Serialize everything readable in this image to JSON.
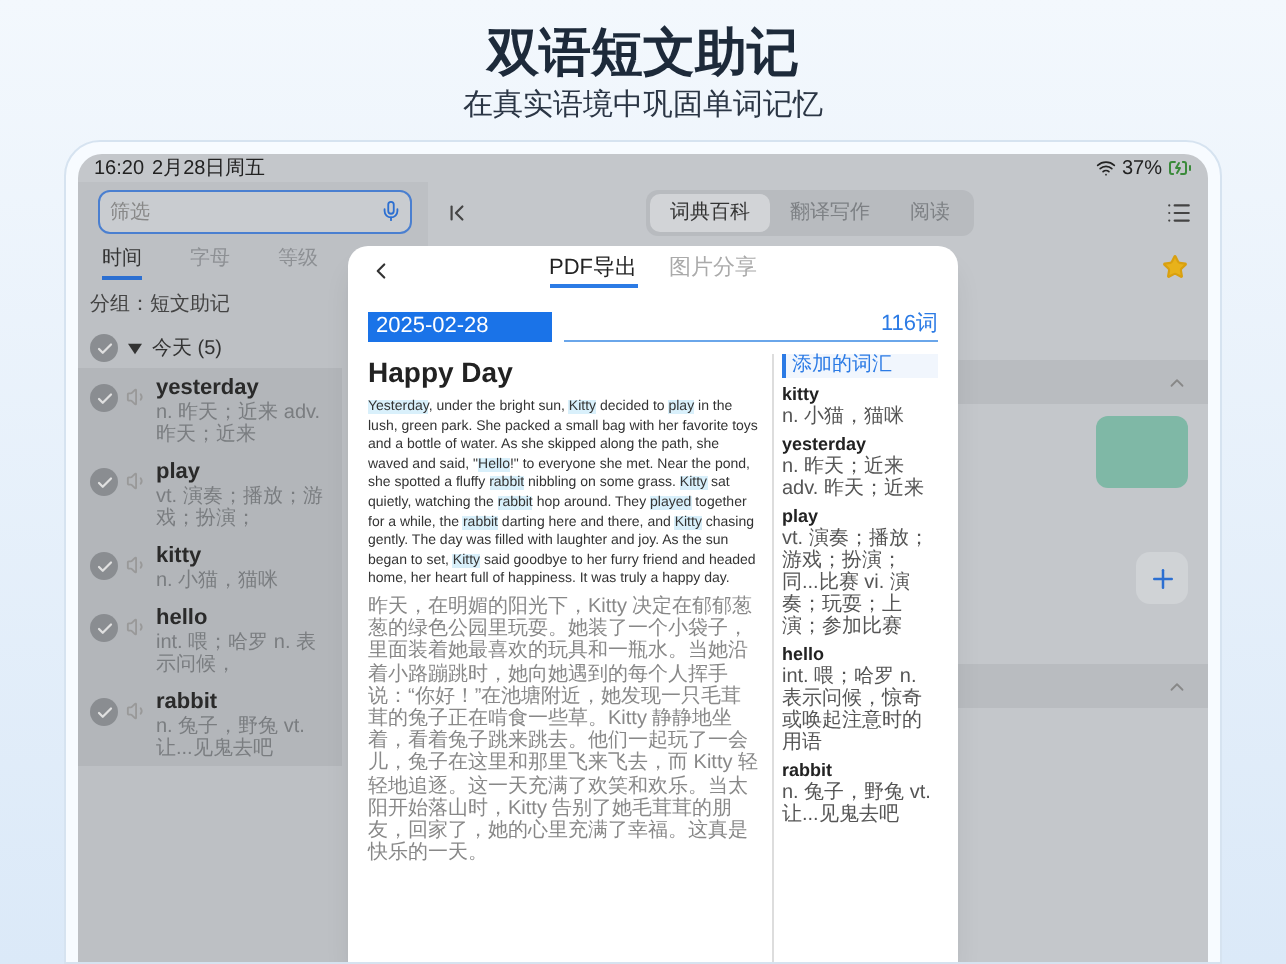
{
  "header": {
    "title": "双语短文助记",
    "subtitle": "在真实语境中巩固单词记忆"
  },
  "status_bar": {
    "time": "16:20",
    "date": "2月28日周五",
    "battery": "37%"
  },
  "sidebar": {
    "search": {
      "placeholder": "筛选"
    },
    "tabs": [
      {
        "label": "时间",
        "selected": true
      },
      {
        "label": "字母",
        "selected": false
      },
      {
        "label": "等级",
        "selected": false
      }
    ],
    "group_label": "分组：短文助记",
    "group": {
      "title": "今天 (5)",
      "checked": true,
      "expanded": true,
      "items": [
        {
          "word": "yesterday",
          "definition": "n. 昨天；近来 adv. 昨天；近来",
          "checked": true
        },
        {
          "word": "play",
          "definition": "vt. 演奏；播放；游戏；扮演；",
          "checked": true
        },
        {
          "word": "kitty",
          "definition": "n. 小猫，猫咪",
          "checked": true
        },
        {
          "word": "hello",
          "definition": "int. 喂；哈罗 n. 表示问候，",
          "checked": true
        },
        {
          "word": "rabbit",
          "definition": "n. 兔子，野兔 vt. 让...见鬼去吧",
          "checked": true
        }
      ]
    }
  },
  "toolbar": {
    "tabs": [
      {
        "label": "词典百科",
        "selected": true
      },
      {
        "label": "翻译写作",
        "selected": false
      },
      {
        "label": "阅读",
        "selected": false
      }
    ]
  },
  "main": {
    "favorite": true
  },
  "export_dialog": {
    "tabs": [
      {
        "label": "PDF导出",
        "selected": true
      },
      {
        "label": "图片分享",
        "selected": false
      }
    ],
    "date": "2025-02-28",
    "word_count": "116词",
    "title": "Happy Day",
    "story": [
      {
        "text": "Yesterday",
        "highlighted": true
      },
      {
        "text": ", under the bright sun, ",
        "highlighted": false
      },
      {
        "text": "Kitty",
        "highlighted": true
      },
      {
        "text": " decided to ",
        "highlighted": false
      },
      {
        "text": "play",
        "highlighted": true
      },
      {
        "text": " in the lush, green park. She packed a small bag with her favorite toys and a bottle of water. As she skipped along the path, she waved and said, \"",
        "highlighted": false
      },
      {
        "text": "Hello",
        "highlighted": true
      },
      {
        "text": "!\" to everyone she met. Near the pond, she spotted a fluffy ",
        "highlighted": false
      },
      {
        "text": "rabbit",
        "highlighted": true
      },
      {
        "text": " nibbling on some grass. ",
        "highlighted": false
      },
      {
        "text": "Kitty",
        "highlighted": true
      },
      {
        "text": " sat quietly, watching the ",
        "highlighted": false
      },
      {
        "text": "rabbit",
        "highlighted": true
      },
      {
        "text": " hop around. They ",
        "highlighted": false
      },
      {
        "text": "played",
        "highlighted": true
      },
      {
        "text": " together for a while, the ",
        "highlighted": false
      },
      {
        "text": "rabbit",
        "highlighted": true
      },
      {
        "text": " darting here and there, and ",
        "highlighted": false
      },
      {
        "text": "Kitty",
        "highlighted": true
      },
      {
        "text": " chasing gently. The day was filled with laughter and joy. As the sun began to set, ",
        "highlighted": false
      },
      {
        "text": "Kitty",
        "highlighted": true
      },
      {
        "text": " said goodbye to her furry friend and headed home, her heart full of happiness. It was truly a happy day.",
        "highlighted": false
      }
    ],
    "translation": "昨天，在明媚的阳光下，Kitty 决定在郁郁葱葱的绿色公园里玩耍。她装了一个小袋子，里面装着她最喜欢的玩具和一瓶水。当她沿着小路蹦跳时，她向她遇到的每个人挥手说：“你好！”在池塘附近，她发现一只毛茸茸的兔子正在啃食一些草。Kitty 静静地坐着，看着兔子跳来跳去。他们一起玩了一会儿，兔子在这里和那里飞来飞去，而 Kitty 轻轻地追逐。这一天充满了欢笑和欢乐。当太阳开始落山时，Kitty 告别了她毛茸茸的朋友，回家了，她的心里充满了幸福。这真是快乐的一天。",
    "vocab_header": "添加的词汇",
    "vocab": [
      {
        "word": "kitty",
        "definition": "n. 小猫，猫咪"
      },
      {
        "word": "yesterday",
        "definition": "n. 昨天；近来 adv. 昨天；近来"
      },
      {
        "word": "play",
        "definition": "vt. 演奏；播放；游戏；扮演；同...比赛 vi. 演奏；玩耍；上演；参加比赛"
      },
      {
        "word": "hello",
        "definition": "int. 喂；哈罗 n. 表示问候，惊奇或唤起注意时的用语"
      },
      {
        "word": "rabbit",
        "definition": "n. 兔子，野兔 vt. 让...见鬼去吧"
      }
    ]
  }
}
